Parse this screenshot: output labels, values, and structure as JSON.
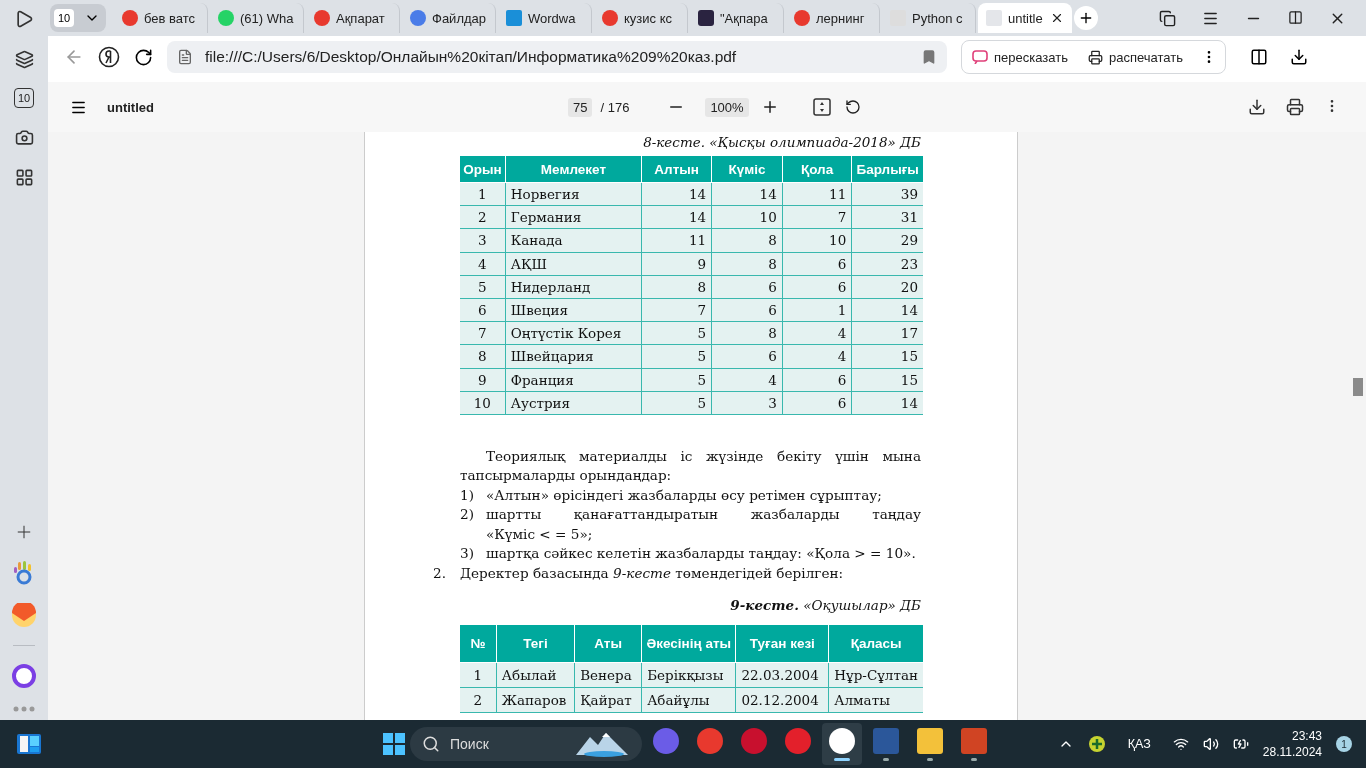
{
  "sidebar": {
    "counter": "10"
  },
  "tabs": {
    "counter": "10",
    "items": [
      {
        "title": "бев ватс",
        "selected": false
      },
      {
        "title": "(61) Wha",
        "selected": false
      },
      {
        "title": "Ақпарат",
        "selected": false
      },
      {
        "title": "Файлдар",
        "selected": false
      },
      {
        "title": "Wordwa",
        "selected": false
      },
      {
        "title": "кузис кс",
        "selected": false
      },
      {
        "title": "\"Ақпара",
        "selected": false
      },
      {
        "title": "лернинг",
        "selected": false
      },
      {
        "title": "Python с",
        "selected": false
      },
      {
        "title": "untitle",
        "selected": true
      }
    ]
  },
  "address_bar": {
    "url": "file:///C:/Users/6/Desktop/Онлайын%20кітап/Информатика%209%20каз.pdf",
    "buttons": [
      "пересказать",
      "распечатать"
    ]
  },
  "pdf_toolbar": {
    "title": "untitled",
    "page": "75",
    "page_count": "/ 176",
    "zoom": "100%"
  },
  "document": {
    "caption_1": "8-кесте. «Қысқы олимпиада-2018» ДБ",
    "table_1": {
      "columns": [
        "Орын",
        "Мемлекет",
        "Алтын",
        "Күміс",
        "Қола",
        "Барлығы"
      ],
      "rows": [
        [
          "1",
          "Норвегия",
          "14",
          "14",
          "11",
          "39"
        ],
        [
          "2",
          "Германия",
          "14",
          "10",
          "7",
          "31"
        ],
        [
          "3",
          "Канада",
          "11",
          "8",
          "10",
          "29"
        ],
        [
          "4",
          "АҚШ",
          "9",
          "8",
          "6",
          "23"
        ],
        [
          "5",
          "Нидерланд",
          "8",
          "6",
          "6",
          "20"
        ],
        [
          "6",
          "Швеция",
          "7",
          "6",
          "1",
          "14"
        ],
        [
          "7",
          "Оңтүстік Корея",
          "5",
          "8",
          "4",
          "17"
        ],
        [
          "8",
          "Швейцария",
          "5",
          "6",
          "4",
          "15"
        ],
        [
          "9",
          "Франция",
          "5",
          "4",
          "6",
          "15"
        ],
        [
          "10",
          "Аустрия",
          "5",
          "3",
          "6",
          "14"
        ]
      ]
    },
    "paragraph": "Теориялық материалды іс жүзінде бекіту үшін мына тапсырмаларды орындаңдар:",
    "tasks": [
      {
        "number": "1)",
        "text": "«Алтын» өрісіндегі жазбаларды өсу ретімен сұрыптау;"
      },
      {
        "number": "2)",
        "text": "шартты қанағаттандыратын жазбаларды таңдау «Күміс < = 5»;"
      },
      {
        "number": "3)",
        "text": "шартқа сәйкес келетін жазбаларды таңдау: «Қола > = 10»."
      }
    ],
    "item_2": {
      "number": "2.",
      "text": "Деректер базасында *9-кесте* төмендегідей берілген:"
    },
    "caption_2": "**9-кесте.** «Оқушылар» ДБ",
    "table_2": {
      "columns": [
        "№",
        "Тегі",
        "Аты",
        "Әкесінің аты",
        "Туған кезі",
        "Қаласы"
      ],
      "rows": [
        [
          "1",
          "Абылай",
          "Венера",
          "Берікқызы",
          "22.03.2004",
          "Нұр-Сұлтан"
        ],
        [
          "2",
          "Жапаров",
          "Қайрат",
          "Абайұлы",
          "02.12.2004",
          "Алматы"
        ]
      ]
    }
  },
  "taskbar": {
    "search_placeholder": "Поиск",
    "apps": [
      {
        "open": false,
        "selected": false
      },
      {
        "open": false,
        "selected": false
      },
      {
        "open": false,
        "selected": false
      },
      {
        "open": false,
        "selected": false
      },
      {
        "open": true,
        "selected": true
      },
      {
        "open": true,
        "selected": false
      },
      {
        "open": true,
        "selected": false
      },
      {
        "open": true,
        "selected": false
      }
    ],
    "language": "ҚАЗ",
    "time": "23:43",
    "date": "28.11.2024",
    "notifications": "1"
  }
}
